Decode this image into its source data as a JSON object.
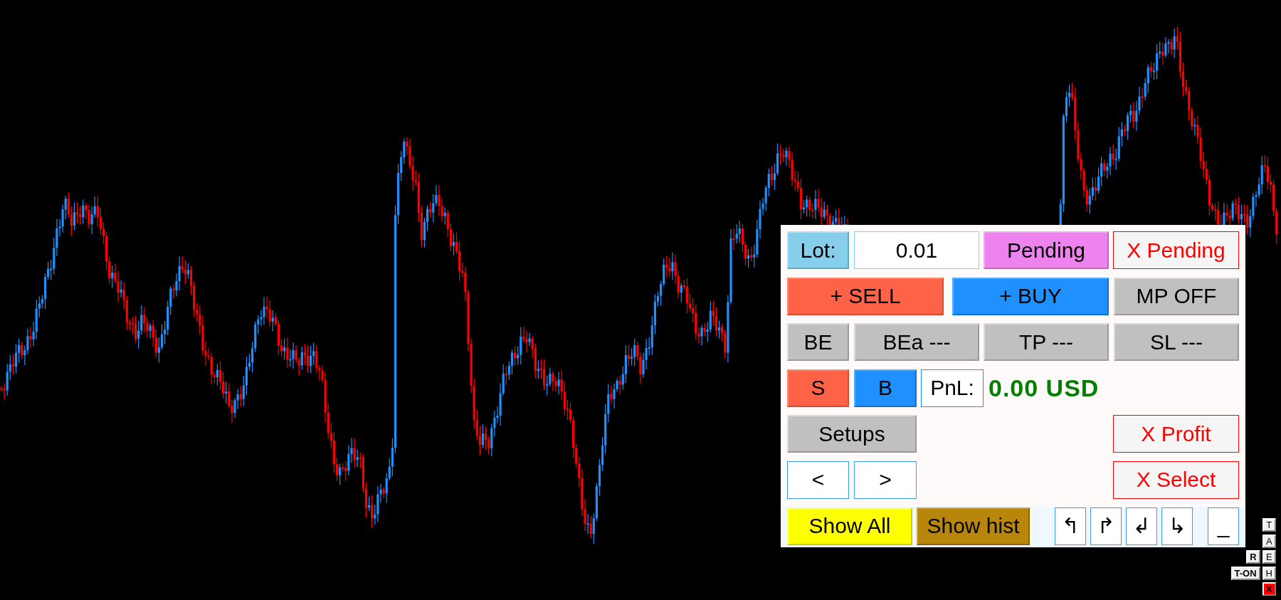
{
  "panel": {
    "rows": [
      [
        {
          "kind": "sky",
          "text": "Lot:"
        },
        {
          "kind": "field",
          "value": "0.01"
        },
        {
          "kind": "violet",
          "text": "Pending"
        },
        {
          "kind": "close",
          "text": "X Pending"
        }
      ],
      [
        {
          "kind": "sell",
          "text": "+ SELL"
        },
        "",
        {
          "kind": "buy",
          "text": "+ BUY"
        },
        {
          "kind": "grey",
          "text": "MP OFF"
        }
      ],
      [
        {
          "kind": "grey",
          "text": "BE"
        },
        {
          "kind": "grey",
          "text": "BEa ---"
        },
        {
          "kind": "grey",
          "text": "TP ---"
        },
        {
          "kind": "grey",
          "text": "SL ---"
        }
      ],
      [
        {
          "kind": "sell",
          "text": "S"
        },
        [
          {
            "kind": "buy",
            "text": "B"
          },
          {
            "kind": "label",
            "text": "PnL:"
          }
        ],
        {
          "kind": "value",
          "text": "0.00 USD"
        }
      ],
      [
        {
          "kind": "grey",
          "text": "Setups"
        },
        "",
        "",
        {
          "kind": "close",
          "text": "X Profit"
        }
      ],
      [
        {
          "kind": "outline",
          "text": "<"
        },
        {
          "kind": "outline",
          "text": ">"
        },
        "",
        {
          "kind": "close",
          "text": "X Select"
        }
      ]
    ],
    "footer": [
      {
        "kind": "yellow",
        "text": "Show All"
      },
      {
        "kind": "gold",
        "text": "Show hist"
      },
      {
        "kind": "arrow",
        "text": "↰"
      },
      {
        "kind": "arrow",
        "text": "↱"
      },
      {
        "kind": "arrow",
        "text": "↲"
      },
      {
        "kind": "arrow",
        "text": "↳"
      },
      {
        "kind": "outline",
        "text": "_"
      }
    ]
  },
  "corner_buttons": {
    "column": [
      {
        "kind": "plain",
        "text": "T"
      },
      {
        "kind": "plain",
        "text": "A"
      },
      {
        "kind": "plain",
        "text": "E"
      },
      {
        "kind": "plain",
        "text": "H"
      },
      {
        "kind": "close",
        "text": "X"
      }
    ],
    "side": [
      {
        "kind": "bold",
        "text": "R"
      },
      {
        "kind": "bold",
        "text": "T-ON"
      }
    ]
  }
}
